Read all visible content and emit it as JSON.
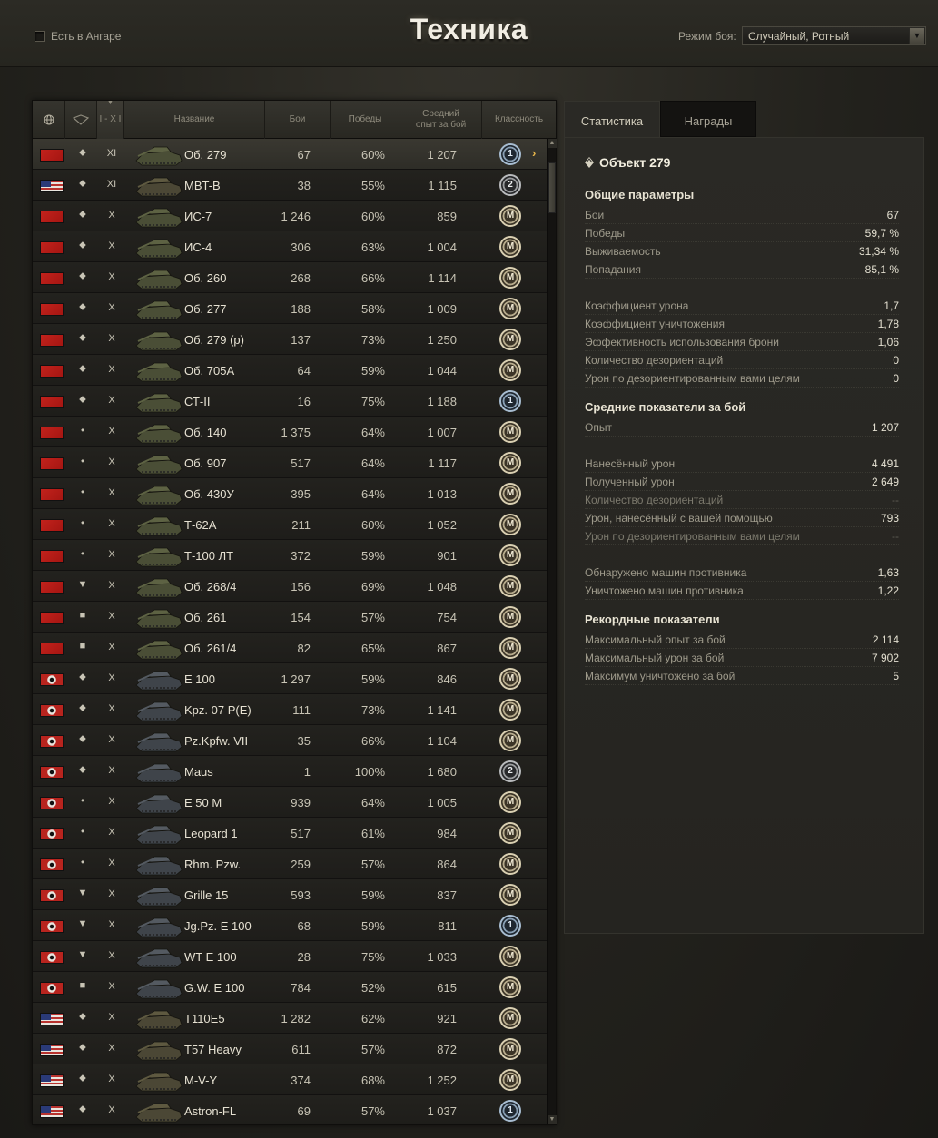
{
  "header": {
    "title": "Техника",
    "hangar_checkbox_label": "Есть в Ангаре",
    "mode_label": "Режим боя:",
    "mode_value": "Случайный, Ротный"
  },
  "table": {
    "columns": {
      "nation": "globe-icon",
      "type": "vehicle-type-icon",
      "tier": "I - X I",
      "name": "Название",
      "battles": "Бои",
      "wins": "Победы",
      "avg_xp": "Средний опыт за бой",
      "mastery": "Классность"
    },
    "rows": [
      {
        "nation": "ussr",
        "type": "⬥",
        "tier": "XI",
        "name": "Об. 279",
        "battles": "67",
        "wins": "60%",
        "avg_xp": "1 207",
        "mastery": "1",
        "selected": true
      },
      {
        "nation": "usa",
        "type": "⬥",
        "tier": "XI",
        "name": "MBT-B",
        "battles": "38",
        "wins": "55%",
        "avg_xp": "1 115",
        "mastery": "2"
      },
      {
        "nation": "ussr",
        "type": "⬥",
        "tier": "X",
        "name": "ИС-7",
        "battles": "1 246",
        "wins": "60%",
        "avg_xp": "859",
        "mastery": "M"
      },
      {
        "nation": "ussr",
        "type": "⬥",
        "tier": "X",
        "name": "ИС-4",
        "battles": "306",
        "wins": "63%",
        "avg_xp": "1 004",
        "mastery": "M"
      },
      {
        "nation": "ussr",
        "type": "⬥",
        "tier": "X",
        "name": "Об. 260",
        "battles": "268",
        "wins": "66%",
        "avg_xp": "1 114",
        "mastery": "M"
      },
      {
        "nation": "ussr",
        "type": "⬥",
        "tier": "X",
        "name": "Об. 277",
        "battles": "188",
        "wins": "58%",
        "avg_xp": "1 009",
        "mastery": "M"
      },
      {
        "nation": "ussr",
        "type": "⬥",
        "tier": "X",
        "name": "Об. 279 (р)",
        "battles": "137",
        "wins": "73%",
        "avg_xp": "1 250",
        "mastery": "M"
      },
      {
        "nation": "ussr",
        "type": "⬥",
        "tier": "X",
        "name": "Об. 705А",
        "battles": "64",
        "wins": "59%",
        "avg_xp": "1 044",
        "mastery": "M"
      },
      {
        "nation": "ussr",
        "type": "⬥",
        "tier": "X",
        "name": "СТ-II",
        "battles": "16",
        "wins": "75%",
        "avg_xp": "1 188",
        "mastery": "1"
      },
      {
        "nation": "ussr",
        "type": "⬩",
        "tier": "X",
        "name": "Об. 140",
        "battles": "1 375",
        "wins": "64%",
        "avg_xp": "1 007",
        "mastery": "M"
      },
      {
        "nation": "ussr",
        "type": "⬩",
        "tier": "X",
        "name": "Об. 907",
        "battles": "517",
        "wins": "64%",
        "avg_xp": "1 117",
        "mastery": "M"
      },
      {
        "nation": "ussr",
        "type": "⬩",
        "tier": "X",
        "name": "Об. 430У",
        "battles": "395",
        "wins": "64%",
        "avg_xp": "1 013",
        "mastery": "M"
      },
      {
        "nation": "ussr",
        "type": "⬩",
        "tier": "X",
        "name": "Т-62А",
        "battles": "211",
        "wins": "60%",
        "avg_xp": "1 052",
        "mastery": "M"
      },
      {
        "nation": "ussr",
        "type": "⬩",
        "tier": "X",
        "name": "Т-100 ЛТ",
        "battles": "372",
        "wins": "59%",
        "avg_xp": "901",
        "mastery": "M"
      },
      {
        "nation": "ussr",
        "type": "▼",
        "tier": "X",
        "name": "Об. 268/4",
        "battles": "156",
        "wins": "69%",
        "avg_xp": "1 048",
        "mastery": "M"
      },
      {
        "nation": "ussr",
        "type": "■",
        "tier": "X",
        "name": "Об. 261",
        "battles": "154",
        "wins": "57%",
        "avg_xp": "754",
        "mastery": "M"
      },
      {
        "nation": "ussr",
        "type": "■",
        "tier": "X",
        "name": "Об. 261/4",
        "battles": "82",
        "wins": "65%",
        "avg_xp": "867",
        "mastery": "M"
      },
      {
        "nation": "ger",
        "type": "⬥",
        "tier": "X",
        "name": "E 100",
        "battles": "1 297",
        "wins": "59%",
        "avg_xp": "846",
        "mastery": "M"
      },
      {
        "nation": "ger",
        "type": "⬥",
        "tier": "X",
        "name": "Kpz. 07 P(E)",
        "battles": "111",
        "wins": "73%",
        "avg_xp": "1 141",
        "mastery": "M"
      },
      {
        "nation": "ger",
        "type": "⬥",
        "tier": "X",
        "name": "Pz.Kpfw. VII",
        "battles": "35",
        "wins": "66%",
        "avg_xp": "1 104",
        "mastery": "M"
      },
      {
        "nation": "ger",
        "type": "⬥",
        "tier": "X",
        "name": "Maus",
        "battles": "1",
        "wins": "100%",
        "avg_xp": "1 680",
        "mastery": "2"
      },
      {
        "nation": "ger",
        "type": "⬩",
        "tier": "X",
        "name": "E 50 M",
        "battles": "939",
        "wins": "64%",
        "avg_xp": "1 005",
        "mastery": "M"
      },
      {
        "nation": "ger",
        "type": "⬩",
        "tier": "X",
        "name": "Leopard 1",
        "battles": "517",
        "wins": "61%",
        "avg_xp": "984",
        "mastery": "M"
      },
      {
        "nation": "ger",
        "type": "⬩",
        "tier": "X",
        "name": "Rhm. Pzw.",
        "battles": "259",
        "wins": "57%",
        "avg_xp": "864",
        "mastery": "M"
      },
      {
        "nation": "ger",
        "type": "▼",
        "tier": "X",
        "name": "Grille 15",
        "battles": "593",
        "wins": "59%",
        "avg_xp": "837",
        "mastery": "M"
      },
      {
        "nation": "ger",
        "type": "▼",
        "tier": "X",
        "name": "Jg.Pz. E 100",
        "battles": "68",
        "wins": "59%",
        "avg_xp": "811",
        "mastery": "1"
      },
      {
        "nation": "ger",
        "type": "▼",
        "tier": "X",
        "name": "WT E 100",
        "battles": "28",
        "wins": "75%",
        "avg_xp": "1 033",
        "mastery": "M"
      },
      {
        "nation": "ger",
        "type": "■",
        "tier": "X",
        "name": "G.W. E 100",
        "battles": "784",
        "wins": "52%",
        "avg_xp": "615",
        "mastery": "M"
      },
      {
        "nation": "usa",
        "type": "⬥",
        "tier": "X",
        "name": "T110E5",
        "battles": "1 282",
        "wins": "62%",
        "avg_xp": "921",
        "mastery": "M"
      },
      {
        "nation": "usa",
        "type": "⬥",
        "tier": "X",
        "name": "T57 Heavy",
        "battles": "611",
        "wins": "57%",
        "avg_xp": "872",
        "mastery": "M"
      },
      {
        "nation": "usa",
        "type": "⬥",
        "tier": "X",
        "name": "M-V-Y",
        "battles": "374",
        "wins": "68%",
        "avg_xp": "1 252",
        "mastery": "M"
      },
      {
        "nation": "usa",
        "type": "⬥",
        "tier": "X",
        "name": "Astron-FL",
        "battles": "69",
        "wins": "57%",
        "avg_xp": "1 037",
        "mastery": "1"
      }
    ]
  },
  "tabs": {
    "stats": "Статистика",
    "awards": "Награды"
  },
  "details": {
    "vehicle_name": "Объект 279",
    "general": {
      "heading": "Общие параметры",
      "rows": [
        {
          "label": "Бои",
          "value": "67"
        },
        {
          "label": "Победы",
          "value": "59,7 %"
        },
        {
          "label": "Выживаемость",
          "value": "31,34 %"
        },
        {
          "label": "Попадания",
          "value": "85,1 %"
        }
      ],
      "rows2": [
        {
          "label": "Коэффициент урона",
          "value": "1,7"
        },
        {
          "label": "Коэффициент уничтожения",
          "value": "1,78"
        },
        {
          "label": "Эффективность использования брони",
          "value": "1,06"
        },
        {
          "label": "Количество дезориентаций",
          "value": "0"
        },
        {
          "label": "Урон по дезориентированным вами целям",
          "value": "0"
        }
      ]
    },
    "average": {
      "heading": "Средние показатели за бой",
      "rows": [
        {
          "label": "Опыт",
          "value": "1 207"
        }
      ],
      "rows2": [
        {
          "label": "Нанесённый урон",
          "value": "4 491"
        },
        {
          "label": "Полученный урон",
          "value": "2 649"
        },
        {
          "label": "Количество дезориентаций",
          "value": "--"
        },
        {
          "label": "Урон, нанесённый с вашей помощью",
          "value": "793"
        },
        {
          "label": "Урон по дезориентированным вами целям",
          "value": "--"
        }
      ],
      "rows3": [
        {
          "label": "Обнаружено машин противника",
          "value": "1,63"
        },
        {
          "label": "Уничтожено машин противника",
          "value": "1,22"
        }
      ]
    },
    "records": {
      "heading": "Рекордные показатели",
      "rows": [
        {
          "label": "Максимальный опыт за бой",
          "value": "2 114"
        },
        {
          "label": "Максимальный урон за бой",
          "value": "7 902"
        },
        {
          "label": "Максимум уничтожено за бой",
          "value": "5"
        }
      ]
    }
  }
}
